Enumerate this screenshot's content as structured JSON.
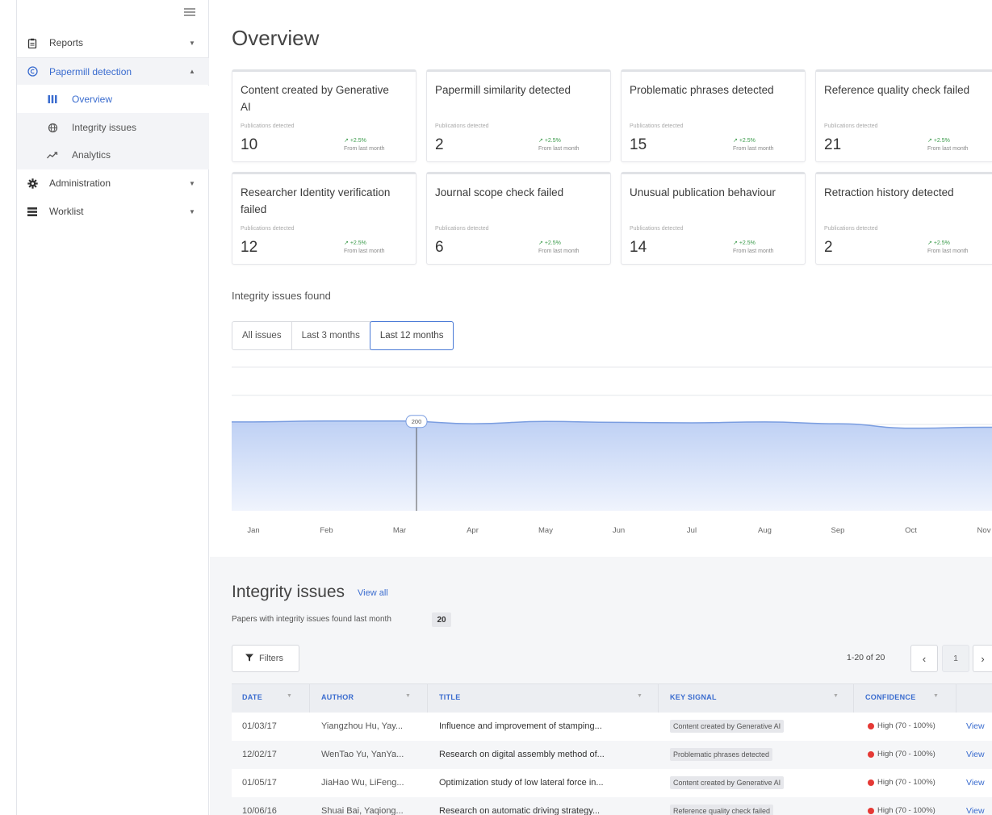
{
  "sidebar": {
    "items": [
      {
        "label": "Reports",
        "icon": "clipboard-icon"
      },
      {
        "label": "Papermill detection",
        "icon": "copyright-circle-icon"
      },
      {
        "label": "Administration",
        "icon": "gear-icon"
      },
      {
        "label": "Worklist",
        "icon": "list-icon"
      }
    ],
    "subitems": [
      {
        "label": "Overview",
        "icon": "bars-icon"
      },
      {
        "label": "Integrity issues",
        "icon": "globe-icon"
      },
      {
        "label": "Analytics",
        "icon": "trend-line-icon"
      }
    ]
  },
  "page": {
    "title": "Overview"
  },
  "cards": [
    {
      "title": "Content created by Generative AI",
      "sub": "Publications detected",
      "value": "10",
      "trend": "+2.5%",
      "from": "From last month"
    },
    {
      "title": "Papermill similarity detected",
      "sub": "Publications detected",
      "value": "2",
      "trend": "+2.5%",
      "from": "From last month"
    },
    {
      "title": "Problematic phrases detected",
      "sub": "Publications detected",
      "value": "15",
      "trend": "+2.5%",
      "from": "From last month"
    },
    {
      "title": "Reference quality check failed",
      "sub": "Publications detected",
      "value": "21",
      "trend": "+2.5%",
      "from": "From last month"
    },
    {
      "title": "Researcher Identity verification failed",
      "sub": "Publications detected",
      "value": "12",
      "trend": "+2.5%",
      "from": "From last month"
    },
    {
      "title": "Journal scope check failed",
      "sub": "Publications detected",
      "value": "6",
      "trend": "+2.5%",
      "from": "From last month"
    },
    {
      "title": "Unusual publication behaviour",
      "sub": "Publications detected",
      "value": "14",
      "trend": "+2.5%",
      "from": "From last month"
    },
    {
      "title": "Retraction history detected",
      "sub": "Publications detected",
      "value": "2",
      "trend": "+2.5%",
      "from": "From last month"
    }
  ],
  "chart_section": {
    "label": "Integrity issues found",
    "tabs": [
      "All issues",
      "Last 3 months",
      "Last 12 months"
    ],
    "active_tab": 2
  },
  "chart_data": {
    "type": "area",
    "categories": [
      "Jan",
      "Feb",
      "Mar",
      "Apr",
      "May",
      "Jun",
      "Jul",
      "Aug",
      "Sep",
      "Oct",
      "Nov"
    ],
    "values": [
      198,
      200,
      200,
      194,
      199,
      197,
      196,
      198,
      194,
      184,
      186
    ],
    "tooltip": {
      "category": "Mar",
      "label": "200"
    },
    "ylim": [
      0,
      320
    ],
    "grid": true,
    "fill_color": "#c9d9f7",
    "line_color": "#7a9de0"
  },
  "issues": {
    "title": "Integrity issues",
    "view_all": "View all",
    "desc": "Papers with integrity issues found last month",
    "count": "20",
    "filters": "Filters",
    "range": "1-20 of 20",
    "page": "1",
    "columns": [
      "DATE",
      "AUTHOR",
      "TITLE",
      "KEY SIGNAL",
      "CONFIDENCE"
    ],
    "rows": [
      {
        "date": "01/03/17",
        "author": "Yiangzhou Hu, Yay...",
        "title": "Influence and improvement of stamping...",
        "signal": "Content created by Generative AI",
        "confidence": "High (70 - 100%)",
        "action": "View"
      },
      {
        "date": "12/02/17",
        "author": "WenTao Yu, YanYa...",
        "title": "Research on digital assembly method of...",
        "signal": "Problematic phrases detected",
        "confidence": "High (70 - 100%)",
        "action": "View"
      },
      {
        "date": "01/05/17",
        "author": "JiaHao Wu, LiFeng...",
        "title": "Optimization study of low lateral force in...",
        "signal": "Content created by Generative AI",
        "confidence": "High (70 - 100%)",
        "action": "View"
      },
      {
        "date": "10/06/16",
        "author": "Shuai Bai, Yaqiong...",
        "title": "Research on automatic driving strategy...",
        "signal": "Reference quality check failed",
        "confidence": "High (70 - 100%)",
        "action": "View"
      }
    ]
  },
  "colors": {
    "accent": "#3a6ccf",
    "danger": "#e53935",
    "success": "#3a9a4a"
  }
}
